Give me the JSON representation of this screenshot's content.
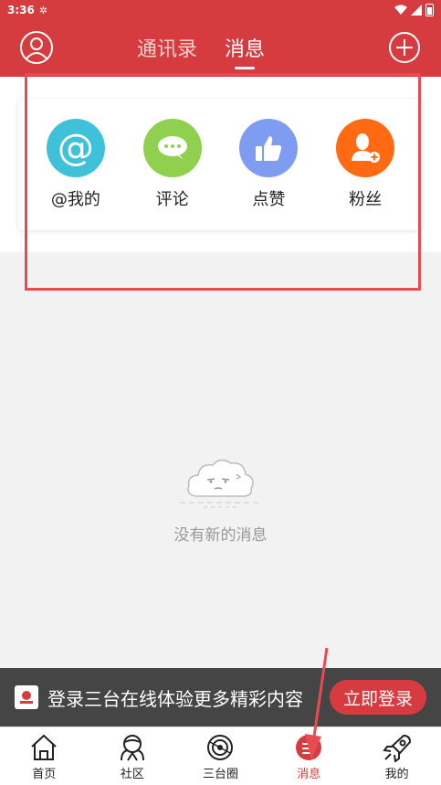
{
  "status_bar": {
    "time": "3:36"
  },
  "header": {
    "tabs": [
      {
        "label": "通讯录",
        "active": false
      },
      {
        "label": "消息",
        "active": true
      }
    ],
    "left_icon": "user-circle-icon",
    "right_icon": "plus-circle-icon"
  },
  "categories": [
    {
      "label": "@我的",
      "color": "#3fc1d9",
      "icon": "at-icon"
    },
    {
      "label": "评论",
      "color": "#8fd14f",
      "icon": "comment-icon"
    },
    {
      "label": "点赞",
      "color": "#7e9cf0",
      "icon": "thumbs-up-icon"
    },
    {
      "label": "粉丝",
      "color": "#ff6a13",
      "icon": "add-follower-icon"
    }
  ],
  "empty_state": {
    "message": "没有新的消息",
    "icon": "cloud-face-icon"
  },
  "login_banner": {
    "text": "登录三台在线体验更多精彩内容",
    "button": "立即登录"
  },
  "bottom_nav": [
    {
      "label": "首页",
      "icon": "home-icon",
      "active": false
    },
    {
      "label": "社区",
      "icon": "community-icon",
      "active": false
    },
    {
      "label": "三台圈",
      "icon": "circle-icon",
      "active": false
    },
    {
      "label": "消息",
      "icon": "message-icon",
      "active": true
    },
    {
      "label": "我的",
      "icon": "rocket-icon",
      "active": false
    }
  ],
  "colors": {
    "brand": "#d63c3f",
    "annotation": "#e84c52"
  }
}
